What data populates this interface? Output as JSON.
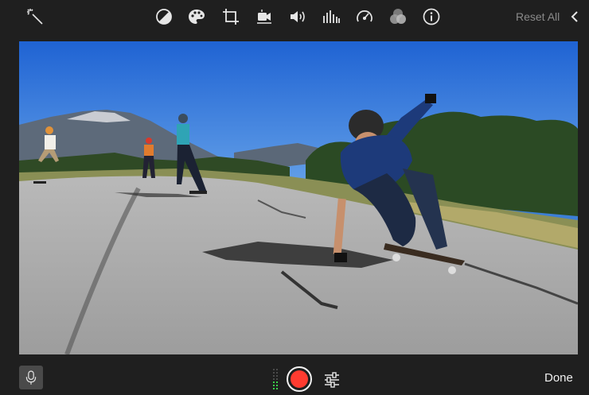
{
  "toolbar": {
    "tools": [
      {
        "icon": "magic-wand-icon"
      },
      {
        "icon": "color-balance-icon"
      },
      {
        "icon": "palette-icon"
      },
      {
        "icon": "crop-icon"
      },
      {
        "icon": "stabilization-icon"
      },
      {
        "icon": "volume-icon"
      },
      {
        "icon": "equalizer-icon"
      },
      {
        "icon": "speed-icon"
      },
      {
        "icon": "filter-overlay-icon"
      },
      {
        "icon": "info-icon"
      }
    ],
    "reset_label": "Reset All"
  },
  "bottom_bar": {
    "done_label": "Done",
    "record_color": "#ff3b30",
    "meter_color": "#3ad04a"
  }
}
